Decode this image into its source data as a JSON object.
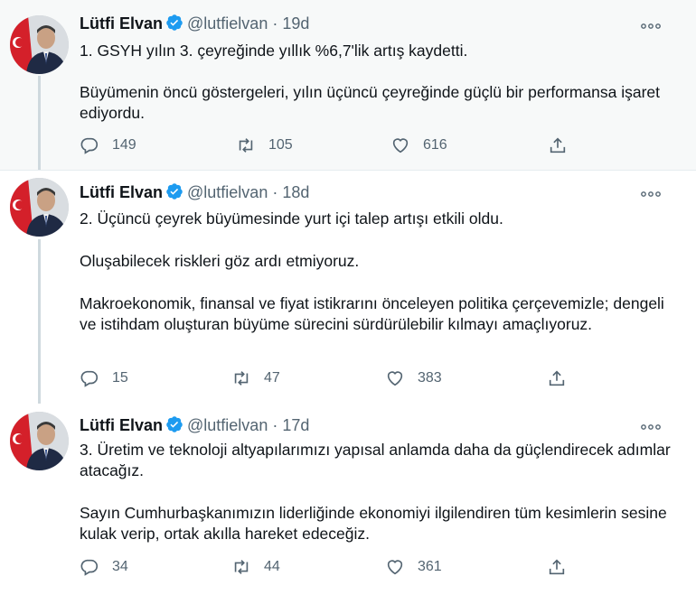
{
  "tweets": [
    {
      "author_name": "Lütfi Elvan",
      "handle": "@lutfielvan",
      "separator": "·",
      "age": "19d",
      "paragraphs": [
        "1. GSYH yılın 3. çeyreğinde yıllık %6,7'lik artış kaydetti.",
        "Büyümenin öncü göstergeleri, yılın üçüncü çeyreğinde güçlü bir performansa işaret ediyordu."
      ],
      "replies": "149",
      "retweets": "105",
      "likes": "616"
    },
    {
      "author_name": "Lütfi Elvan",
      "handle": "@lutfielvan",
      "separator": "·",
      "age": "18d",
      "paragraphs": [
        "2. Üçüncü çeyrek büyümesinde yurt içi talep artışı etkili oldu.",
        "Oluşabilecek riskleri göz ardı etmiyoruz.",
        "Makroekonomik, finansal ve fiyat istikrarını önceleyen politika çerçevemizle; dengeli ve istihdam oluşturan büyüme sürecini sürdürülebilir kılmayı amaçlıyoruz."
      ],
      "replies": "15",
      "retweets": "47",
      "likes": "383"
    },
    {
      "author_name": "Lütfi Elvan",
      "handle": "@lutfielvan",
      "separator": "·",
      "age": "17d",
      "paragraphs": [
        "3. Üretim ve teknoloji altyapılarımızı yapısal anlamda daha da güçlendirecek adımlar atacağız.",
        "Sayın Cumhurbaşkanımızın liderliğinde ekonomiyi ilgilendiren tüm kesimlerin sesine kulak verip, ortak akılla hareket edeceğiz."
      ],
      "replies": "34",
      "retweets": "44",
      "likes": "361"
    }
  ],
  "icons": {
    "verified": "verified-badge-icon",
    "more": "more-horizontal-icon",
    "reply": "reply-icon",
    "retweet": "retweet-icon",
    "like": "heart-icon",
    "share": "share-icon"
  },
  "colors": {
    "text": "#0f1419",
    "muted": "#536471",
    "verified": "#1d9bf0",
    "thread_line": "#cfd9de",
    "highlight_bg": "#f7f9f9"
  }
}
